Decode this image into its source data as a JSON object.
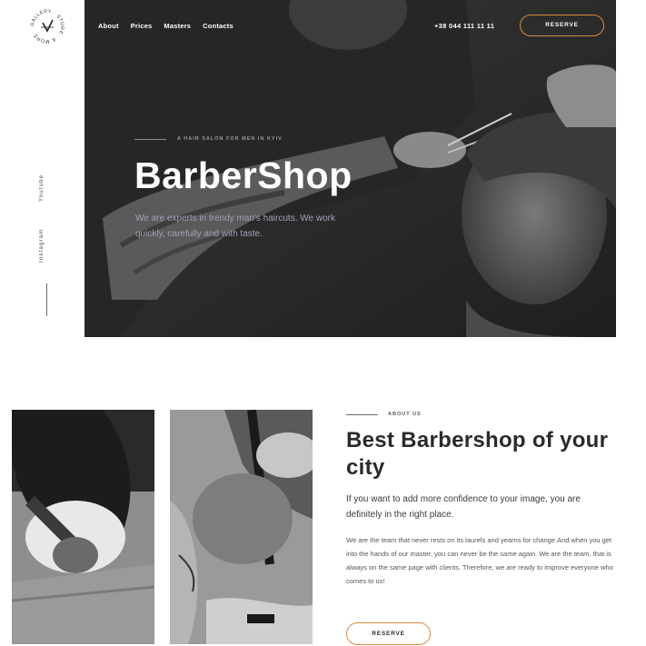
{
  "brand": {
    "logo_text": "GALLERY · STORE · & MORE"
  },
  "social": {
    "youtube": "Youtube",
    "instagram": "Instagram"
  },
  "nav": {
    "items": [
      {
        "label": "About"
      },
      {
        "label": "Prices"
      },
      {
        "label": "Masters"
      },
      {
        "label": "Contacts"
      }
    ],
    "phone": "+38 044 111 11 11",
    "reserve_label": "RESERVE"
  },
  "hero": {
    "kicker": "A HAIR SALON FOR MEN IN KYIV",
    "title": "BarberShop",
    "description": "We are experts in trendy man's haircuts. We work quickly, carefully and with taste."
  },
  "about": {
    "kicker": "ABOUT US",
    "title": "Best Barbershop of your city",
    "lead": "If you want to add more confidence to your image, you are definitely in the right place.",
    "body": "We are the team that never rests on its laurels and yearns for change.And when you get into the hands of our master, you can never be the same again. We are the team, that is always on the same page with clients. Therefore, we are ready to improve everyone who comes to us!",
    "reserve_label": "RESERVE"
  },
  "colors": {
    "accent": "#d98a3f",
    "hero_bg": "#2e2e2e",
    "text_dark": "#2b2b2b",
    "hero_desc": "#9fa3b5"
  }
}
